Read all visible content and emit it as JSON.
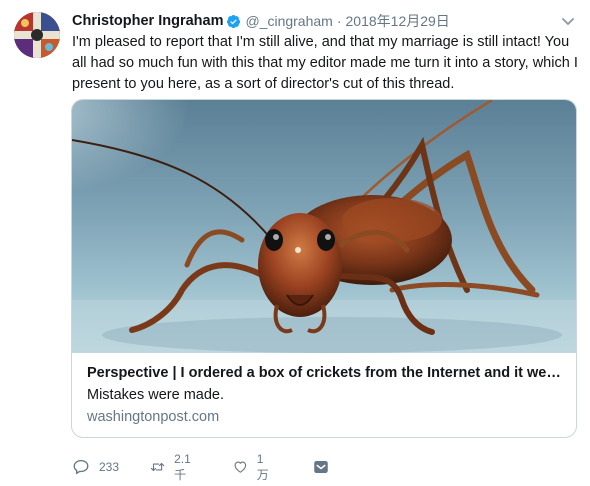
{
  "author": {
    "name": "Christopher Ingraham",
    "handle": "@_cingraham",
    "verified": true,
    "avatar_icon": "avatar-image"
  },
  "tweet": {
    "separator": "·",
    "timestamp": "2018年12月29日",
    "text": "I'm pleased to report that I'm still alive, and that my marriage is still intact! You all had so much fun with this that my editor made me turn it into a story, which I present to you here, as a sort of director's cut of this thread."
  },
  "card": {
    "image_icon": "cricket-photo",
    "title": "Perspective | I ordered a box of crickets from the Internet and it went...",
    "description": "Mistakes were made.",
    "domain": "washingtonpost.com"
  },
  "actions": {
    "reply_count": "233",
    "retweet_count": "2.1千",
    "like_count": "1万"
  },
  "colors": {
    "text": "#14171a",
    "secondary": "#657786",
    "verified": "#1da1f2",
    "border": "#ccd6dd"
  }
}
